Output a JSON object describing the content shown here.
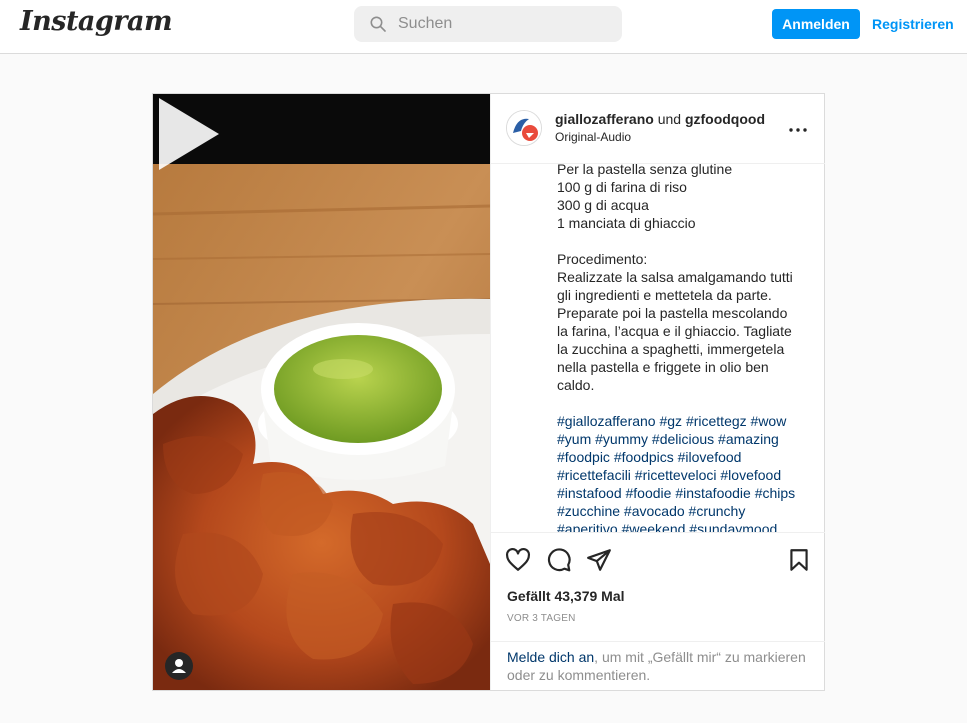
{
  "header": {
    "logo_text": "Instagram",
    "search": {
      "placeholder": "Suchen",
      "icon": "search-icon"
    },
    "login_label": "Anmelden",
    "register_label": "Registrieren",
    "accent_color": "#0095f6"
  },
  "post": {
    "author1": "giallozafferano",
    "connector": "und",
    "author2": "gzfoodqood",
    "audio": "Original-Audio",
    "caption_lines": [
      "Per la pastella senza glutine",
      "100 g di farina di riso",
      "300 g di acqua",
      "1 manciata di ghiaccio",
      "",
      "Procedimento:",
      "Realizzate la salsa amalgamando tutti",
      "gli ingredienti e mettetela da parte.",
      "Preparate poi la pastella mescolando",
      "la farina, l’acqua e il ghiaccio. Tagliate",
      "la zucchina a spaghetti, immergetela",
      "nella pastella e friggete in olio ben",
      "caldo."
    ],
    "hashtag_lines": [
      "#giallozafferano #gz #ricettegz #wow",
      "#yum #yummy #delicious #amazing",
      "#foodpic #foodpics #ilovefood",
      "#ricettefacili #ricetteveloci #lovefood",
      "#instafood #foodie #instafoodie #chips",
      "#zucchine #avocado #crunchy",
      "#aperitivo #weekend #sundaymood"
    ],
    "likes": "Gefällt 43,379 Mal",
    "age": "VOR 3 TAGEN",
    "login_link": "Melde dich an",
    "login_rest": ", um mit „Gefällt mir“ zu markieren oder zu kommentieren.",
    "icons": [
      "heart-icon",
      "comment-icon",
      "share-icon",
      "bookmark-icon",
      "more-icon",
      "play-icon",
      "user-tag-icon"
    ]
  }
}
